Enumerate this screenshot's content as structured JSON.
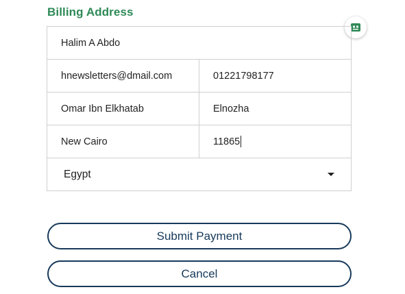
{
  "billing": {
    "title": "Billing Address",
    "full_name": "Halim A Abdo",
    "email": "hnewsletters@dmail.com",
    "phone": "01221798177",
    "address1": "Omar Ibn Elkhatab",
    "address2": "Elnozha",
    "city": "New Cairo",
    "postal_code": "11865",
    "country": "Egypt"
  },
  "actions": {
    "submit_label": "Submit Payment",
    "cancel_label": "Cancel"
  },
  "colors": {
    "title_green": "#2e8a57",
    "button_navy": "#16395a",
    "badge_green": "#2e8a57"
  },
  "icons": {
    "password_manager": "password-manager-icon",
    "country_dropdown": "chevron-down-icon"
  }
}
